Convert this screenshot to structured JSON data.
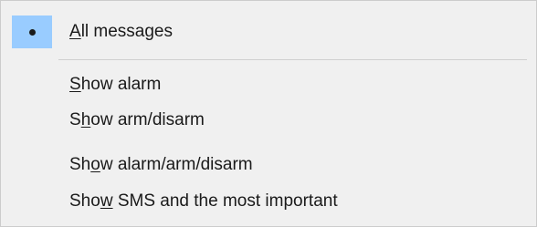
{
  "menu": {
    "items": [
      {
        "pre": "",
        "key": "A",
        "post": "ll messages",
        "checked": true
      },
      {
        "pre": "",
        "key": "S",
        "post": "how alarm",
        "checked": false
      },
      {
        "pre": "S",
        "key": "h",
        "post": "ow arm/disarm",
        "checked": false
      },
      {
        "pre": "Sh",
        "key": "o",
        "post": "w alarm/arm/disarm",
        "checked": false
      },
      {
        "pre": "Sho",
        "key": "w",
        "post": " SMS and the most important",
        "checked": false
      }
    ]
  },
  "colors": {
    "menu_background": "#f0f0f0",
    "check_highlight": "#99ccff",
    "separator": "#cfcfcf",
    "text": "#1a1a1a"
  },
  "icons": {
    "checked_marker": "radio-bullet-icon"
  }
}
